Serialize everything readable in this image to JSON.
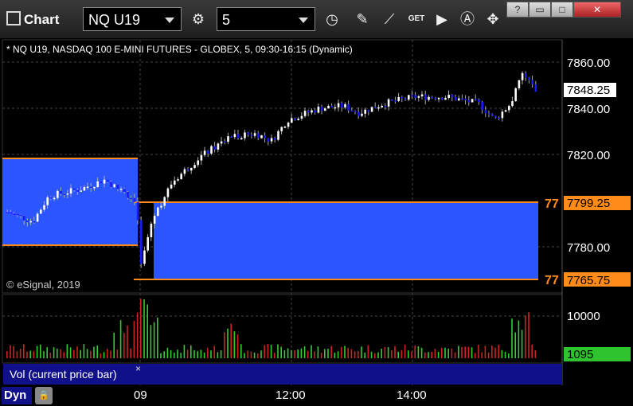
{
  "window": {
    "title": "Chart"
  },
  "toolbar": {
    "symbol": "NQ U19",
    "interval": "5",
    "icons": [
      "settings-gear-icon",
      "clock-icon",
      "pencil-icon",
      "indicator-icon",
      "get-icon",
      "play-icon",
      "alert-icon",
      "tools-icon"
    ]
  },
  "window_controls": [
    "help-icon",
    "restore-icon",
    "maximize-icon",
    "close-icon"
  ],
  "chart": {
    "description": "* NQ U19, NASDAQ 100 E-MINI FUTURES - GLOBEX, 5, 09:30-16:15 (Dynamic)",
    "copyright": "© eSignal, 2019",
    "price_ticks": [
      "7860.00",
      "7840.00",
      "7820.00",
      "7780.00"
    ],
    "last_price": "7848.25",
    "level_high": "7799.25",
    "level_low": "7765.75",
    "level_prefix": "77",
    "volume_tick": "10000",
    "volume_value": "1095",
    "volume_label": "Vol (current price bar)",
    "volume_close": "×",
    "time_ticks": [
      "09",
      "12:00",
      "14:00"
    ],
    "mode": "Dyn",
    "colors": {
      "up": "#ffffff",
      "down": "#1a1aff",
      "zone": "#2a55ff",
      "level": "#ff8c1a",
      "vol_up": "#33cc33",
      "vol_down": "#cc2222"
    }
  }
}
